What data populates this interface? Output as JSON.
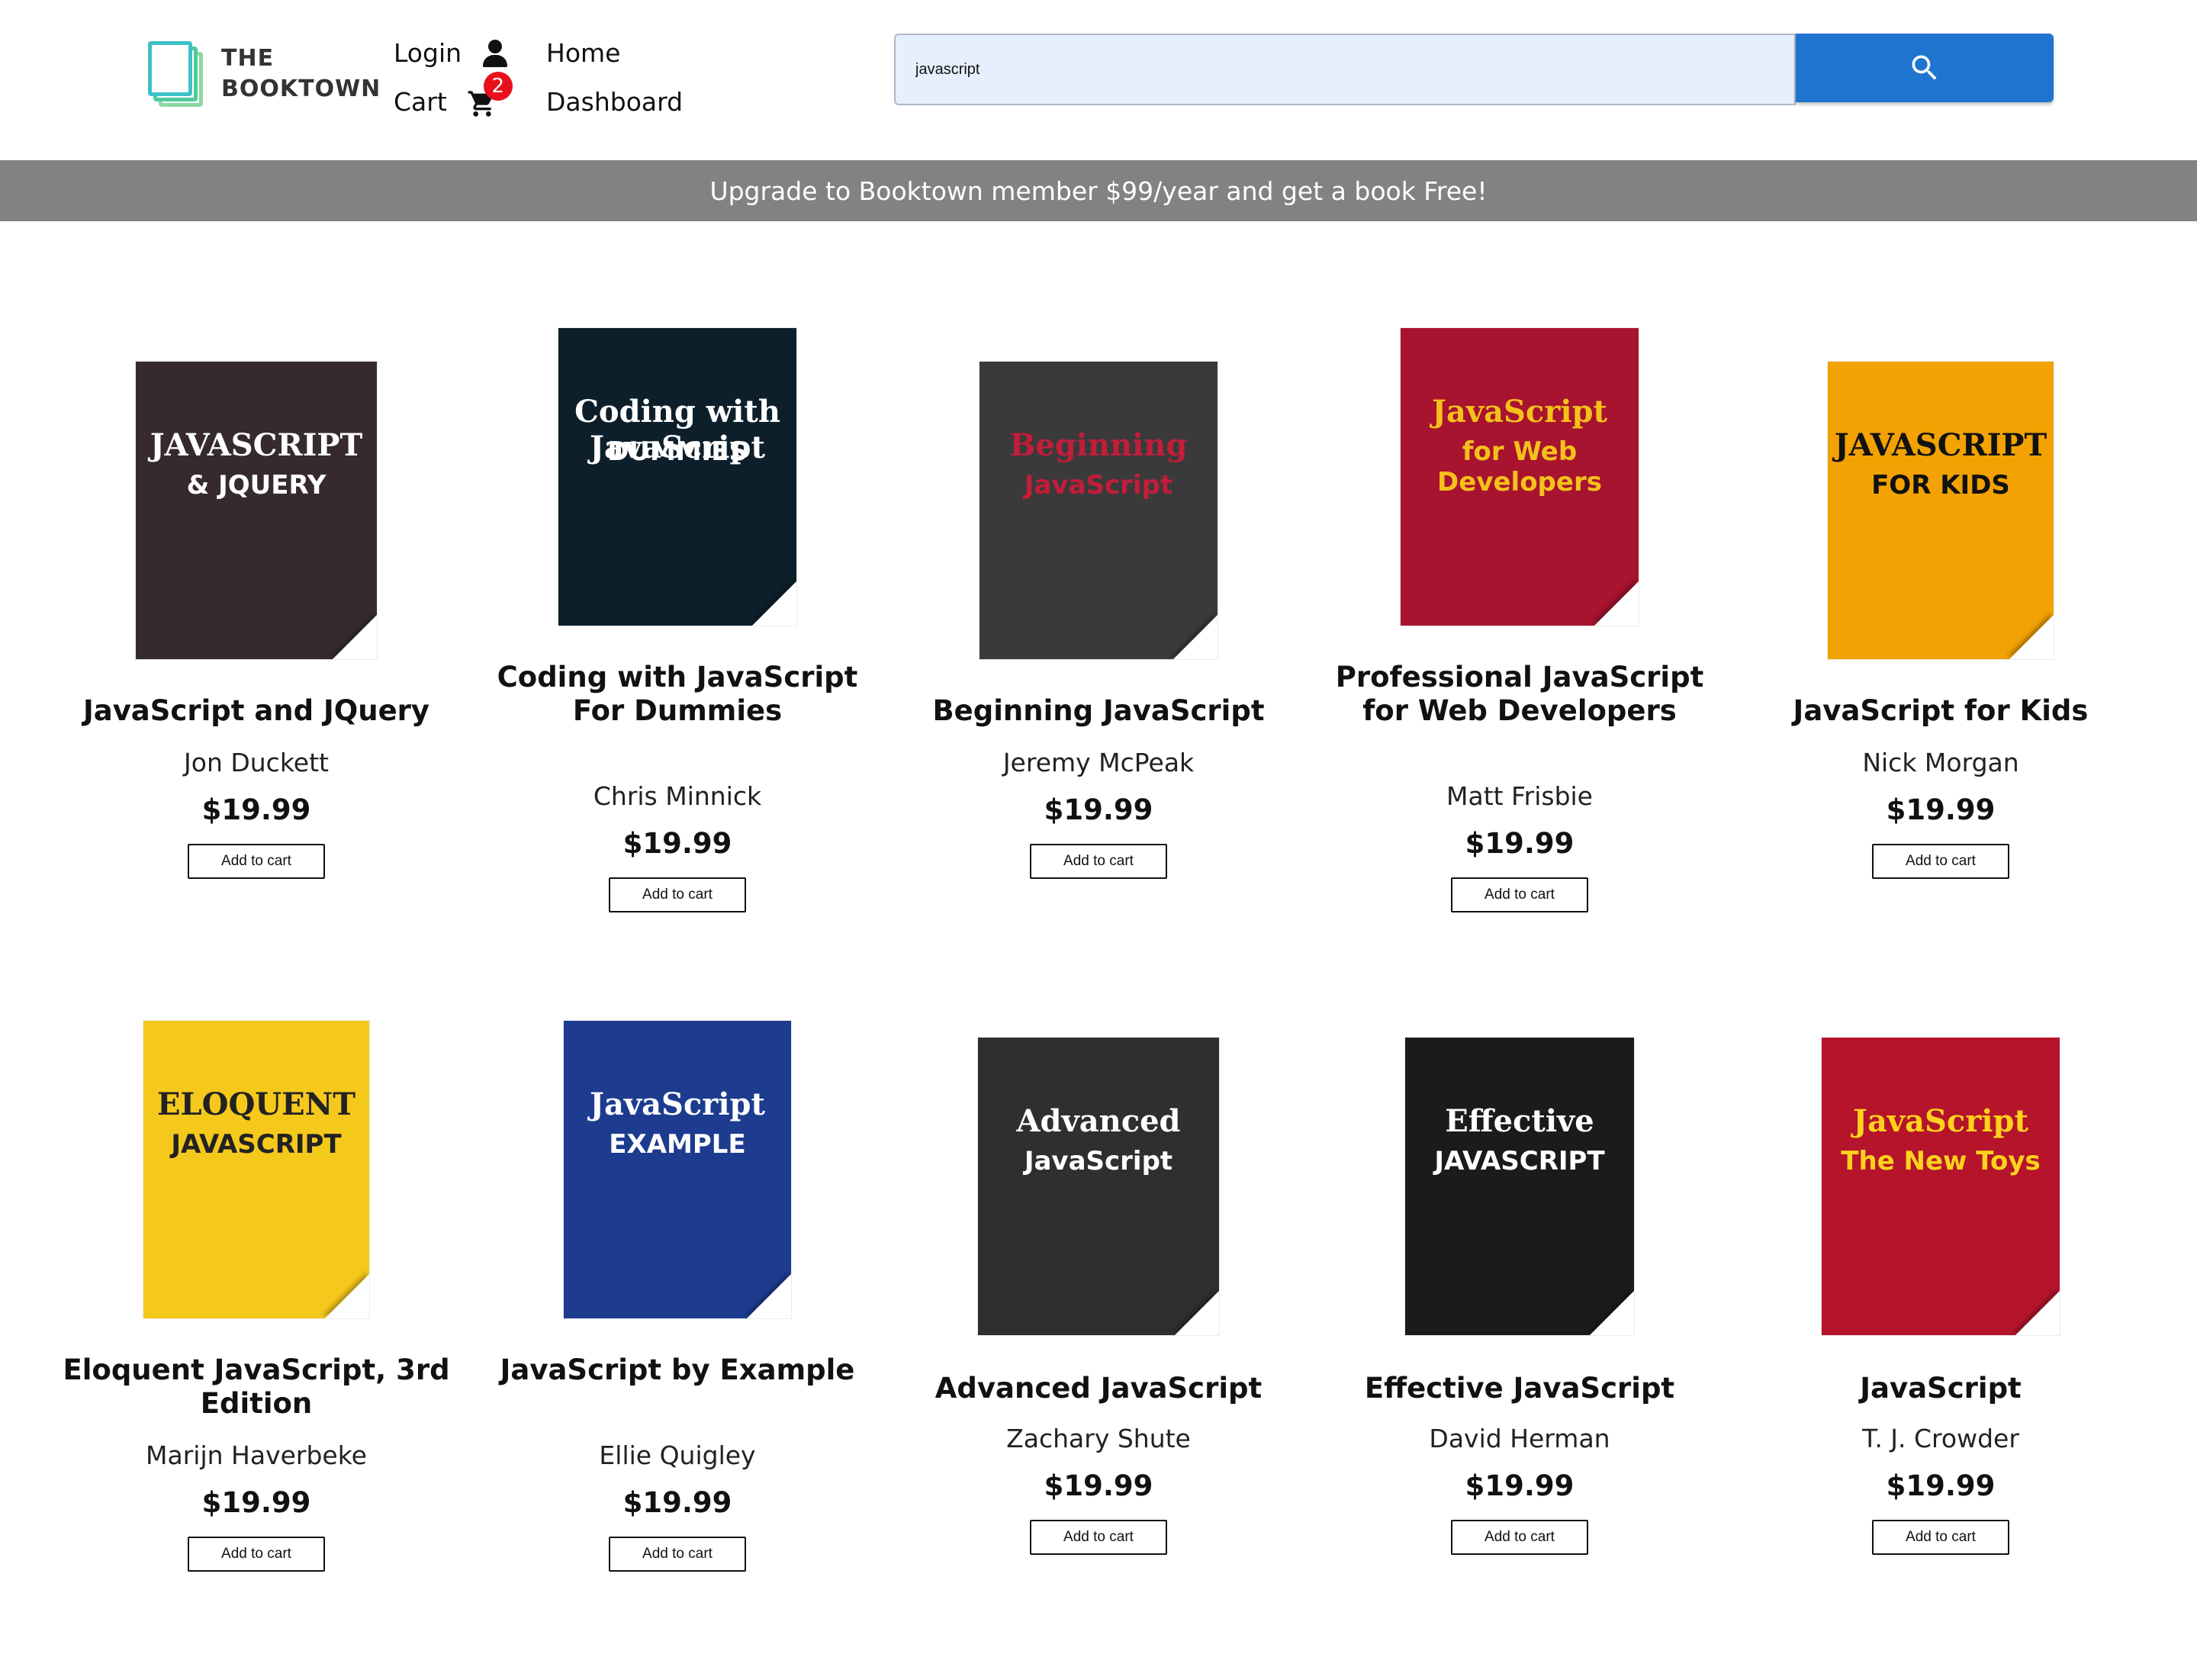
{
  "header": {
    "logo_line1": "THE",
    "logo_line2": "BOOKTOWN",
    "login_label": "Login",
    "cart_label": "Cart",
    "cart_count": "2",
    "home_label": "Home",
    "dashboard_label": "Dashboard",
    "search_value": "javascript"
  },
  "banner": {
    "text": "Upgrade to Booktown member $99/year and get a book Free!"
  },
  "books": [
    {
      "title": "JavaScript and JQuery",
      "author": "Jon Duckett",
      "price": "$19.99",
      "button": "Add to cart",
      "cover": {
        "line1": "JAVASCRIPT",
        "line2": "& JQUERY",
        "bg": "#362a2d",
        "fg": "#ffffff"
      }
    },
    {
      "title": "Coding with JavaScript For Dummies",
      "author": "Chris Minnick",
      "price": "$19.99",
      "button": "Add to cart",
      "cover": {
        "line1": "Coding with JavaScript",
        "line2": "DUMMIES",
        "bg": "#0d1f2b",
        "fg": "#ffffff"
      }
    },
    {
      "title": "Beginning JavaScript",
      "author": "Jeremy McPeak",
      "price": "$19.99",
      "button": "Add to cart",
      "cover": {
        "line1": "Beginning",
        "line2": "JavaScript",
        "bg": "#3a3a3a",
        "fg": "#c21d3a"
      }
    },
    {
      "title": "Professional JavaScript for Web Developers",
      "author": "Matt Frisbie",
      "price": "$19.99",
      "button": "Add to cart",
      "cover": {
        "line1": "JavaScript",
        "line2": "for Web Developers",
        "bg": "#a8132f",
        "fg": "#f4c11a"
      }
    },
    {
      "title": "JavaScript for Kids",
      "author": "Nick Morgan",
      "price": "$19.99",
      "button": "Add to cart",
      "cover": {
        "line1": "JAVASCRIPT",
        "line2": "FOR KIDS",
        "bg": "#f2a203",
        "fg": "#111111"
      }
    },
    {
      "title": "Eloquent JavaScript, 3rd Edition",
      "author": "Marijn Haverbeke",
      "price": "$19.99",
      "button": "Add to cart",
      "cover": {
        "line1": "ELOQUENT",
        "line2": "JAVASCRIPT",
        "bg": "#f5c81c",
        "fg": "#222222"
      }
    },
    {
      "title": "JavaScript by Example",
      "author": "Ellie Quigley",
      "price": "$19.99",
      "button": "Add to cart",
      "cover": {
        "line1": "JavaScript",
        "line2": "EXAMPLE",
        "bg": "#1d3b8f",
        "fg": "#ffffff"
      }
    },
    {
      "title": "Advanced JavaScript",
      "author": "Zachary Shute",
      "price": "$19.99",
      "button": "Add to cart",
      "cover": {
        "line1": "Advanced",
        "line2": "JavaScript",
        "bg": "#2f2f2f",
        "fg": "#ffffff"
      }
    },
    {
      "title": "Effective JavaScript",
      "author": "David Herman",
      "price": "$19.99",
      "button": "Add to cart",
      "cover": {
        "line1": "Effective",
        "line2": "JAVASCRIPT",
        "bg": "#1b1b1b",
        "fg": "#ffffff"
      }
    },
    {
      "title": "JavaScript",
      "author": "T. J. Crowder",
      "price": "$19.99",
      "button": "Add to cart",
      "cover": {
        "line1": "JavaScript",
        "line2": "The New Toys",
        "bg": "#b5142b",
        "fg": "#ffd21c"
      }
    }
  ]
}
